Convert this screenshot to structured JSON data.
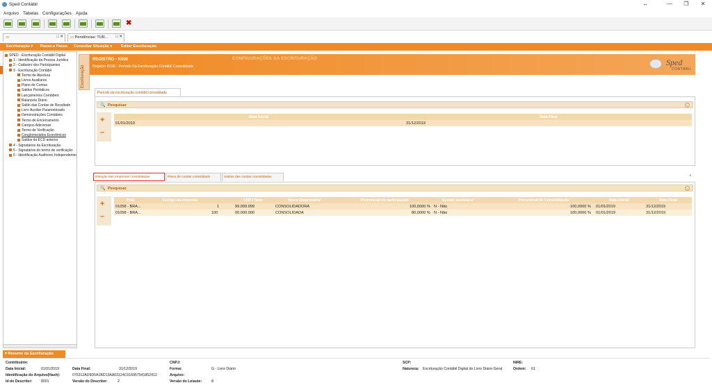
{
  "window": {
    "title": "Sped Contábil",
    "controls": [
      "↔",
      "—",
      "❐",
      "✕"
    ]
  },
  "menu": [
    "Arquivo",
    "Tabelas",
    "Configurações",
    "Ajuda"
  ],
  "doc_tabs": [
    {
      "label": ""
    },
    {
      "label": "Pendências: TUR..."
    }
  ],
  "orange_menu": [
    "Escrituração ▾",
    "Passo a Passo",
    "Consultar Situação ▾",
    "Editar Escrituração"
  ],
  "tree": [
    {
      "label": "SPED - Escrituração Contábil Digital",
      "lvl": 0
    },
    {
      "label": "1 - Identificação da Pessoa Jurídica",
      "lvl": 1
    },
    {
      "label": "2 - Cadastro dos Participantes",
      "lvl": 1
    },
    {
      "label": "3 - Escrituração Contábil",
      "lvl": 1
    },
    {
      "label": "Termo de Abertura",
      "lvl": 2
    },
    {
      "label": "Livros Auxiliares",
      "lvl": 2
    },
    {
      "label": "Plano de Contas",
      "lvl": 2
    },
    {
      "label": "Saldos Periódicos",
      "lvl": 2
    },
    {
      "label": "Lançamentos Contábeis",
      "lvl": 2
    },
    {
      "label": "Balancete Diário",
      "lvl": 2
    },
    {
      "label": "Saldo das Contas de Resultado",
      "lvl": 2
    },
    {
      "label": "Livro Auxiliar Parametrizado",
      "lvl": 2
    },
    {
      "label": "Demonstrações Contábeis",
      "lvl": 2
    },
    {
      "label": "Termo de Encerramento",
      "lvl": 2
    },
    {
      "label": "Campos Adicionais",
      "lvl": 2
    },
    {
      "label": "Termo de Verificação",
      "lvl": 2
    },
    {
      "label": "Conglomerados Econômicos",
      "lvl": 2,
      "underline": true
    },
    {
      "label": "Saldos da ECD anterior",
      "lvl": 2
    },
    {
      "label": "4 - Signatários da Escrituração",
      "lvl": 1
    },
    {
      "label": "5 - Signatários do termo de verificação",
      "lvl": 1
    },
    {
      "label": "6 - Identificação Auditores Independentes",
      "lvl": 1
    }
  ],
  "side_tab": "Escrituração",
  "registro": {
    "code": "REGISTRO - K030",
    "desc": "Registro K030 - Período Da Escrituração Contábil Consolidada",
    "watermark": "CONFIGURAÇÕES DA ESCRITURAÇÃO"
  },
  "logo": {
    "line1": "Sped",
    "line2": "CONTÁBIL"
  },
  "panel1": {
    "tab": "Período da escrituração contábil consolidada",
    "search": "Pesquisar",
    "columns": [
      "Data Inicial",
      "Data Final"
    ],
    "rows": [
      [
        "01/01/2019",
        "31/12/2019"
      ]
    ]
  },
  "panel2": {
    "tabs": [
      "Relação das empresas consolidadas",
      "Plano de contas consolidado",
      "Saldos das contas consolidadas"
    ],
    "search": "Pesquisar",
    "columns": [
      "País",
      "Código da empresa",
      "CNPJ base",
      "Nome Empresarial",
      "Percentual de participação",
      "Evento societário",
      "Percentual de Consolidação",
      "Data Inicial",
      "Data Final"
    ],
    "rows": [
      [
        "01058 - BRA...",
        "1",
        "99.999.999",
        "CONSOLIDADORA",
        "100,0000 %",
        "N - Não",
        "100,0000 %",
        "01/01/2019",
        "31/12/2019"
      ],
      [
        "01058 - BRA...",
        "100",
        "00.000.000",
        "CONSOLIDADA",
        "80,0000 %",
        "N - Não",
        "100,0000 %",
        "01/01/2019",
        "31/12/2019"
      ]
    ]
  },
  "summary": {
    "tab": "▾ Resumo da Escrituração",
    "contribuinte_lbl": "Contribuinte:",
    "data_inicial_lbl": "Data Inicial:",
    "data_inicial": "01/01/2019",
    "data_final_lbl": "Data Final:",
    "data_final": "31/12/2019",
    "hash_lbl": "Identificação do Arquivo(Hash):",
    "hash": "075312AD9D5A1BD13AA03124C016957541852412",
    "id_desc_lbl": "Id do Descritor:",
    "id_desc": "8001",
    "versao_desc_lbl": "Versão do Descritor:",
    "versao_desc": "2",
    "cnpj_lbl": "CNPJ:",
    "forma_lbl": "Forma:",
    "forma": "G - Livro Diário",
    "arquivo_lbl": "Arquivo:",
    "versao_leiaute_lbl": "Versão do Leiaute:",
    "versao_leiaute": "8",
    "scp_lbl": "SCP:",
    "natureza_lbl": "Natureza:",
    "natureza": "Escrituração Contábil Digital do Livro Diário Geral",
    "nire_lbl": "NIRE:",
    "ordem_lbl": "Ordem:",
    "ordem": "61"
  }
}
